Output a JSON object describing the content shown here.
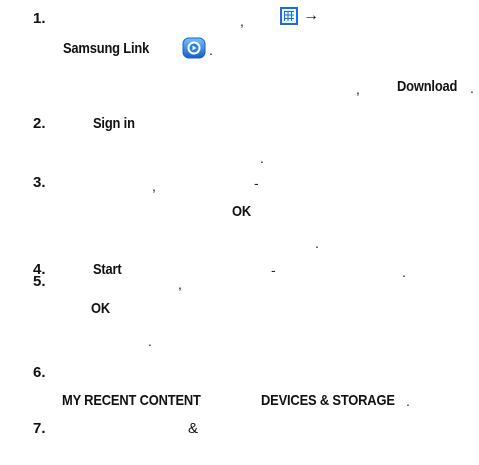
{
  "steps": [
    {
      "n": "1.",
      "samsung_link": "Samsung Link",
      "comma": ",",
      "period_after_icon": ".",
      "comma2": ",",
      "download": "Download",
      "period": "."
    },
    {
      "n": "2.",
      "sign_in": "Sign in",
      "period": "."
    },
    {
      "n": "3.",
      "comma": ",",
      "dash": "-",
      "ok": "OK",
      "period": "."
    },
    {
      "n": "4.",
      "start": "Start",
      "dash": "-",
      "period": "."
    },
    {
      "n": "5.",
      "comma": ",",
      "ok": "OK",
      "period": "."
    },
    {
      "n": "6.",
      "my_recent_content": "MY RECENT CONTENT",
      "devices_storage": "DEVICES & STORAGE",
      "period": "."
    },
    {
      "n": "7.",
      "amp": "&"
    }
  ],
  "icons": {
    "apps": "apps-grid-icon",
    "arrow": "→",
    "samsung_link": "samsung-link-icon"
  },
  "colors": {
    "accent": "#1a6fd6",
    "text": "#111111"
  }
}
